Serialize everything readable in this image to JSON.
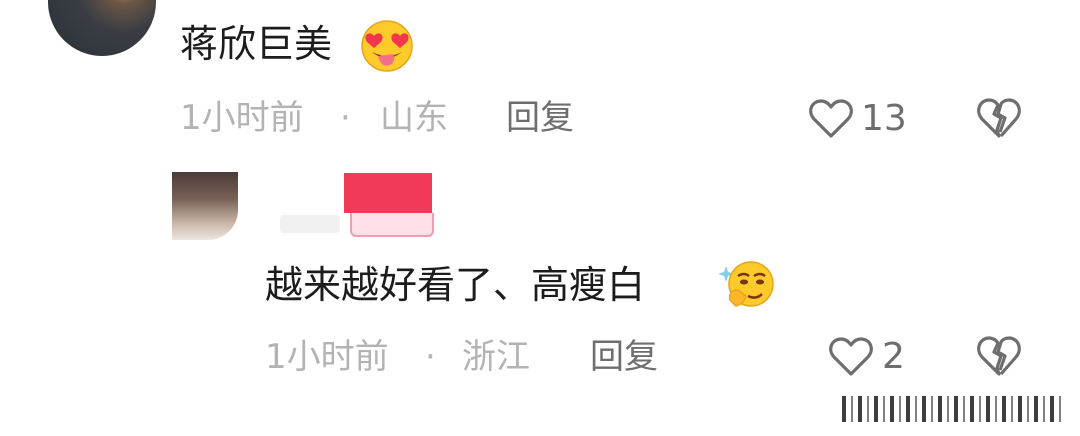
{
  "comments": [
    {
      "text": "蒋欣巨美",
      "emoji": "heart-eyes-tongue-emoji",
      "time": "1小时前",
      "dot": "·",
      "location": "山东",
      "reply_label": "回复",
      "likes": "13"
    },
    {
      "text": "越来越好看了、高瘦白",
      "emoji": "thinking-sparkle-emoji",
      "time": "1小时前",
      "dot": "·",
      "location": "浙江",
      "reply_label": "回复",
      "likes": "2"
    }
  ],
  "colors": {
    "text": "#1c1c1c",
    "meta": "#b3b3b3",
    "action": "#6e6e6e",
    "author_tag": "#f3395a"
  }
}
